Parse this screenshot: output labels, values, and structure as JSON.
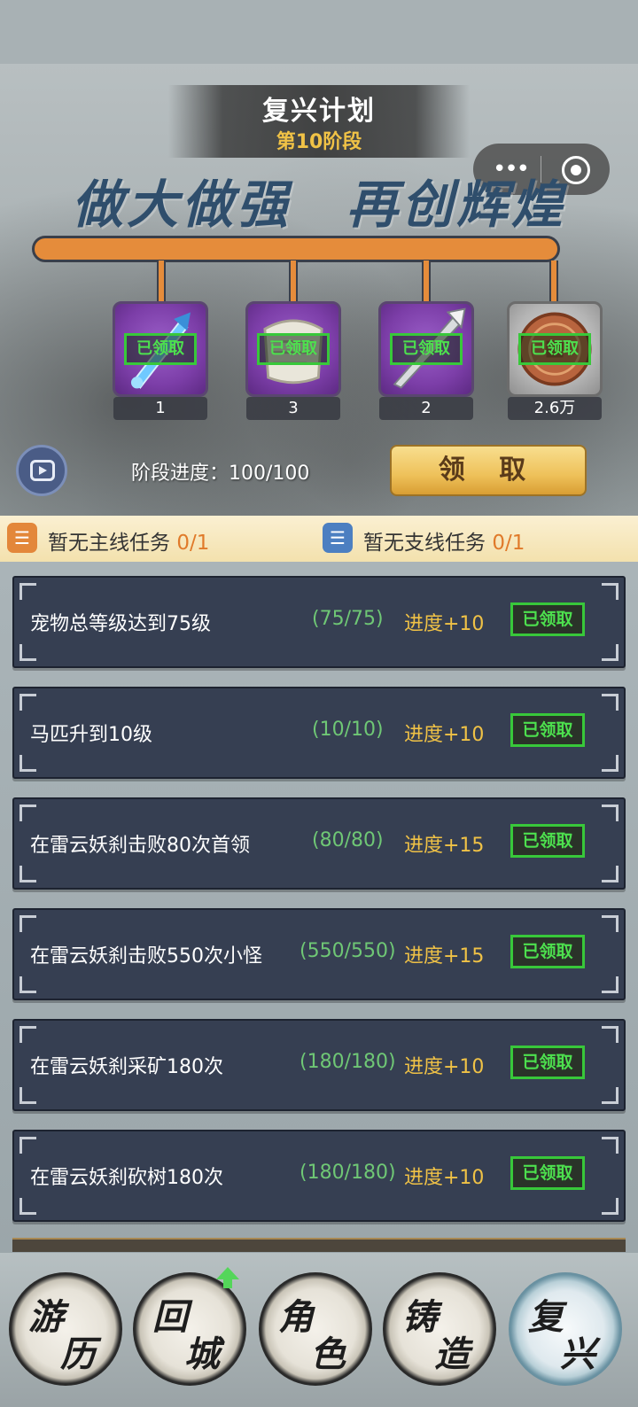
{
  "header": {
    "title": "复兴计划",
    "stage": "第10阶段",
    "slogan": "做大做强　再创辉煌",
    "capsule": {
      "more_icon": "dots-icon",
      "close_icon": "target-icon"
    }
  },
  "rewards": [
    {
      "icon": "sword-icon",
      "status": "已领取",
      "count": "1"
    },
    {
      "icon": "scroll-icon",
      "status": "已领取",
      "count": "3"
    },
    {
      "icon": "spear-icon",
      "status": "已领取",
      "count": "2"
    },
    {
      "icon": "coin-icon",
      "status": "已领取",
      "count": "2.6万"
    }
  ],
  "progress": {
    "label": "阶段进度：100/100",
    "value": 100,
    "max": 100
  },
  "claim_button": "领 取",
  "tasks": {
    "main": {
      "label": "暂无主线任务",
      "count": "0/1"
    },
    "side": {
      "label": "暂无支线任务",
      "count": "0/1"
    }
  },
  "quests": [
    {
      "name": "宠物总等级达到75级",
      "count": "(75/75)",
      "reward": "进度+10",
      "status": "已领取"
    },
    {
      "name": "马匹升到10级",
      "count": "(10/10)",
      "reward": "进度+10",
      "status": "已领取"
    },
    {
      "name": "在雷云妖刹击败80次首领",
      "count": "(80/80)",
      "reward": "进度+15",
      "status": "已领取"
    },
    {
      "name": "在雷云妖刹击败550次小怪",
      "count": "(550/550)",
      "reward": "进度+15",
      "status": "已领取"
    },
    {
      "name": "在雷云妖刹采矿180次",
      "count": "(180/180)",
      "reward": "进度+10",
      "status": "已领取"
    },
    {
      "name": "在雷云妖刹砍树180次",
      "count": "(180/180)",
      "reward": "进度+10",
      "status": "已领取"
    }
  ],
  "nav": [
    {
      "c1": "游",
      "c2": "历"
    },
    {
      "c1": "回",
      "c2": "城"
    },
    {
      "c1": "角",
      "c2": "色"
    },
    {
      "c1": "铸",
      "c2": "造"
    },
    {
      "c1": "复",
      "c2": "兴"
    }
  ],
  "colors": {
    "accent_orange": "#e58c3b",
    "claimed_green": "#38c83a",
    "gold": "#f0c246",
    "quest_bg": "#363f52"
  }
}
